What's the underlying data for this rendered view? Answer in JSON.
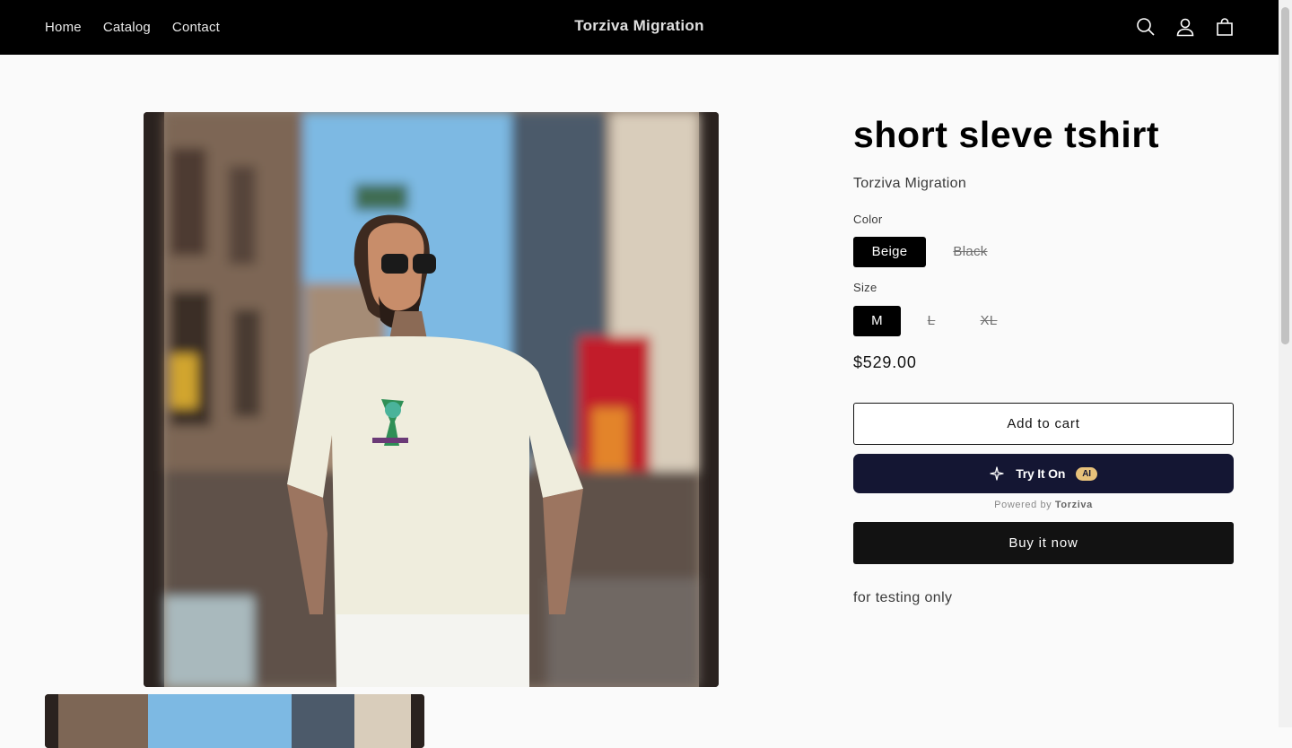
{
  "header": {
    "nav": [
      "Home",
      "Catalog",
      "Contact"
    ],
    "brand": "Torziva Migration",
    "icons": [
      "search-icon",
      "account-icon",
      "cart-icon"
    ]
  },
  "product": {
    "title": "short sleve tshirt",
    "vendor": "Torziva Migration",
    "color_label": "Color",
    "colors": [
      {
        "label": "Beige",
        "state": "selected"
      },
      {
        "label": "Black",
        "state": "sold-out"
      }
    ],
    "size_label": "Size",
    "sizes": [
      {
        "label": "M",
        "state": "selected"
      },
      {
        "label": "L",
        "state": "sold-out"
      },
      {
        "label": "XL",
        "state": "sold-out"
      }
    ],
    "price": "$529.00",
    "add_to_cart": "Add to cart",
    "try_on": "Try It On",
    "ai_badge": "AI",
    "powered_prefix": "Powered by",
    "powered_brand": "Torziva",
    "buy_now": "Buy it now",
    "description": "for testing only"
  },
  "colors": {
    "header_bg": "#000000",
    "try_on_bg": "#141633",
    "ai_badge": "#e7c17a",
    "button_dark": "#121212"
  }
}
